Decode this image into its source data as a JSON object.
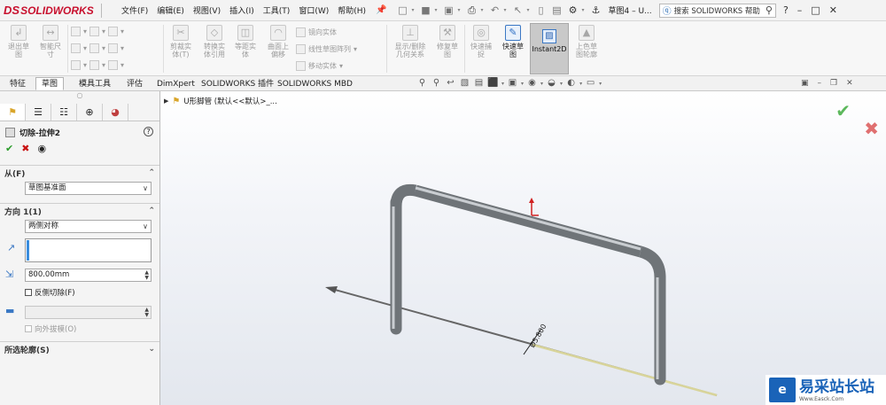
{
  "app": {
    "brand": "SOLIDWORKS",
    "brand_mark": "DS"
  },
  "menu": [
    "文件(F)",
    "编辑(E)",
    "视图(V)",
    "插入(I)",
    "工具(T)",
    "窗口(W)",
    "帮助(H)"
  ],
  "document_title": "草图4 – U...",
  "search": {
    "placeholder": "搜索 SOLIDWORKS 帮助"
  },
  "ribbon": {
    "exit_sketch": "退出草\n图",
    "smart_dim": "智能尺\n寸",
    "trim": "剪裁实\n体(T)",
    "convert": "转换实\n体引用",
    "offset_entities": "等距实\n体",
    "surface_offset": "曲面上\n偏移",
    "mirror": "镜向实体",
    "linear_pattern": "线性草图阵列",
    "move": "移动实体",
    "display_relations": "显示/删除\n几何关系",
    "repair": "修复草\n图",
    "quick_snaps": "快速捕\n捉",
    "rapid_sketch": "快速草\n图",
    "instant2d": "Instant2D",
    "shaded_sketch": "上色草\n图轮廓"
  },
  "tabs": [
    "特征",
    "草图",
    "模具工具",
    "评估",
    "DimXpert",
    "SOLIDWORKS 插件",
    "SOLIDWORKS MBD"
  ],
  "active_tab": "草图",
  "property_manager": {
    "title": "切除-拉伸2",
    "from_label": "从(F)",
    "from_value": "草图基准面",
    "direction_label": "方向 1(1)",
    "direction_value": "两侧对称",
    "depth_value": "800.00mm",
    "reverse_cut": "反侧切除(F)",
    "draft_outward": "向外拔模(O)",
    "selected_contours": "所选轮廓(S)"
  },
  "tree": {
    "item": "U形脚管 (默认<<默认>_..."
  },
  "dimension_label": "Ø5.800",
  "watermark": {
    "name": "易采站长站",
    "url": "Www.Easck.Com"
  }
}
